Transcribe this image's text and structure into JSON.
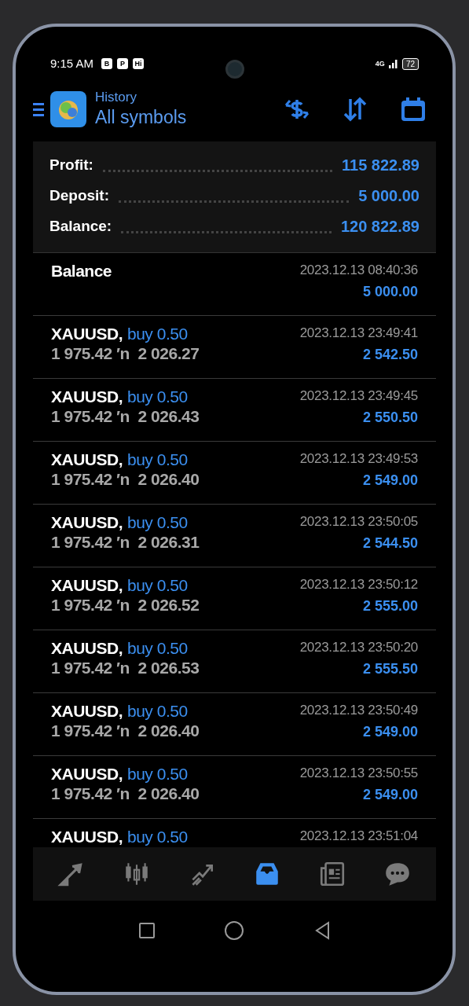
{
  "status_bar": {
    "time": "9:15 AM",
    "notification_badges": [
      "B",
      "P",
      "Hi"
    ],
    "network": "4G",
    "battery": "72"
  },
  "app_bar": {
    "subtitle": "History",
    "title": "All symbols"
  },
  "summary": [
    {
      "label": "Profit:",
      "value": "115 822.89"
    },
    {
      "label": "Deposit:",
      "value": "5 000.00"
    },
    {
      "label": "Balance:",
      "value": "120 822.89"
    }
  ],
  "history": [
    {
      "kind": "balance",
      "title": "Balance",
      "time": "2023.12.13 08:40:36",
      "amount": "5 000.00"
    },
    {
      "kind": "trade",
      "symbol": "XAUUSD,",
      "type": "buy 0.50",
      "prices": "1 975.42 ′n  2 026.27",
      "time": "2023.12.13 23:49:41",
      "amount": "2 542.50"
    },
    {
      "kind": "trade",
      "symbol": "XAUUSD,",
      "type": "buy 0.50",
      "prices": "1 975.42 ′n  2 026.43",
      "time": "2023.12.13 23:49:45",
      "amount": "2 550.50"
    },
    {
      "kind": "trade",
      "symbol": "XAUUSD,",
      "type": "buy 0.50",
      "prices": "1 975.42 ′n  2 026.40",
      "time": "2023.12.13 23:49:53",
      "amount": "2 549.00"
    },
    {
      "kind": "trade",
      "symbol": "XAUUSD,",
      "type": "buy 0.50",
      "prices": "1 975.42 ′n  2 026.31",
      "time": "2023.12.13 23:50:05",
      "amount": "2 544.50"
    },
    {
      "kind": "trade",
      "symbol": "XAUUSD,",
      "type": "buy 0.50",
      "prices": "1 975.42 ′n  2 026.52",
      "time": "2023.12.13 23:50:12",
      "amount": "2 555.00"
    },
    {
      "kind": "trade",
      "symbol": "XAUUSD,",
      "type": "buy 0.50",
      "prices": "1 975.42 ′n  2 026.53",
      "time": "2023.12.13 23:50:20",
      "amount": "2 555.50"
    },
    {
      "kind": "trade",
      "symbol": "XAUUSD,",
      "type": "buy 0.50",
      "prices": "1 975.42 ′n  2 026.40",
      "time": "2023.12.13 23:50:49",
      "amount": "2 549.00"
    },
    {
      "kind": "trade",
      "symbol": "XAUUSD,",
      "type": "buy 0.50",
      "prices": "1 975.42 ′n  2 026.40",
      "time": "2023.12.13 23:50:55",
      "amount": "2 549.00"
    },
    {
      "kind": "trade",
      "symbol": "XAUUSD,",
      "type": "buy 0.50",
      "time": "2023.12.13 23:51:04"
    }
  ],
  "bottom_nav": [
    {
      "kind": "quotes",
      "selected": false
    },
    {
      "kind": "chart",
      "selected": false
    },
    {
      "kind": "trade",
      "selected": false
    },
    {
      "kind": "history",
      "selected": true
    },
    {
      "kind": "news",
      "selected": false
    },
    {
      "kind": "messages",
      "selected": false
    }
  ]
}
